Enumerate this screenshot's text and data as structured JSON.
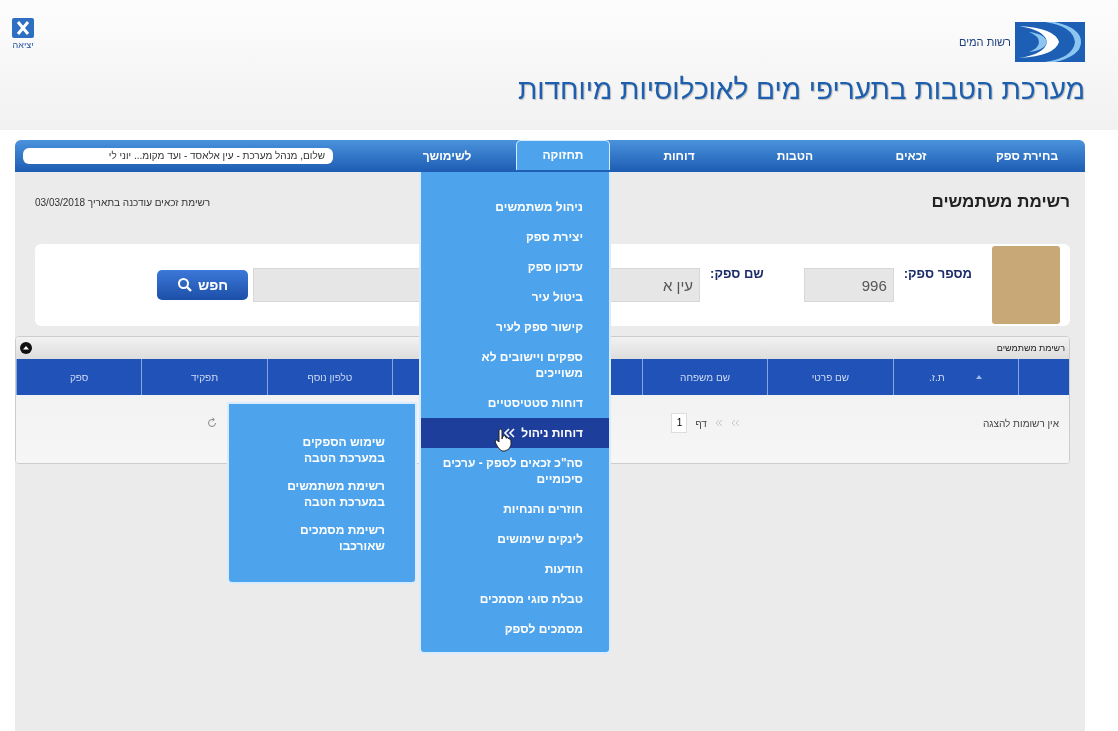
{
  "header": {
    "logo_text": "רשות המים",
    "title": "מערכת הטבות בתעריפי מים לאוכלוסיות מיוחדות",
    "exit_label": "יציאה"
  },
  "nav": {
    "tabs": [
      {
        "label": "בחירת ספק",
        "selected": false
      },
      {
        "label": "זכאים",
        "selected": false
      },
      {
        "label": "הטבות",
        "selected": false
      },
      {
        "label": "דוחות",
        "selected": false
      },
      {
        "label": "תחזוקה",
        "selected": true,
        "menu": [
          {
            "label": "ניהול משתמשים",
            "selected": false
          },
          {
            "label": "יצירת ספק",
            "selected": false
          },
          {
            "label": "עדכון ספק",
            "selected": false
          },
          {
            "label": "ביטול עיר",
            "selected": false
          },
          {
            "label": "קישור ספק לעיר",
            "selected": false
          },
          {
            "label": "ספקים ויישובים לא משוייכים",
            "selected": false
          },
          {
            "label": "דוחות סטטיסטיים",
            "selected": false
          },
          {
            "label": "דוחות ניהול",
            "selected": true,
            "submenu": [
              {
                "label": "שימוש הספקים במערכת הטבה"
              },
              {
                "label": "רשימת משתמשים במערכת הטבה"
              },
              {
                "label": "רשימת מסמכים שאורכבו"
              }
            ]
          },
          {
            "label": "סה\"כ זכאים לספק - ערכים סיכומיים",
            "selected": false
          },
          {
            "label": "חוזרים והנחיות",
            "selected": false
          },
          {
            "label": "לינקים שימושים",
            "selected": false
          },
          {
            "label": "הודעות",
            "selected": false
          },
          {
            "label": "טבלת סוגי מסמכים",
            "selected": false
          },
          {
            "label": "מסמכים לספק",
            "selected": false
          }
        ]
      },
      {
        "label": "לשימושך",
        "selected": false
      }
    ],
    "greeting": "שלום, מנהל מערכת - עין אלאסד - ועד מקומ... יוני לי"
  },
  "page": {
    "heading": "רשימת משתמשים",
    "update_note": "רשימת זכאים עודכנה בתאריך 03/03/2018"
  },
  "search": {
    "fields": [
      {
        "label": "מספר ספק:",
        "value": "996"
      },
      {
        "label": "שם ספק:",
        "value": "עין א"
      }
    ],
    "button": "חפש"
  },
  "grid": {
    "caption": "רשימת משתמשים",
    "columns": [
      {
        "label": "ת.ז.",
        "sorted": true
      },
      {
        "label": "שם פרטי",
        "sorted": false
      },
      {
        "label": "שם משפחה",
        "sorted": false
      },
      {
        "label": "טלפון נוסף",
        "sorted": false
      },
      {
        "label": "תפקיד",
        "sorted": false
      },
      {
        "label": "ספק",
        "sorted": false
      }
    ],
    "empty_message": "אין רשומות להצגה",
    "pager": {
      "page_label": "דף",
      "page": "1"
    }
  }
}
